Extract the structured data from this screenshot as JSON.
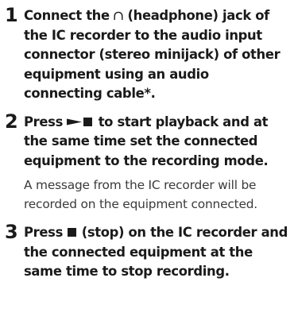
{
  "steps": [
    {
      "number": "1",
      "title_before_icon": "Connect the ",
      "title_after_icon": " (headphone) jack of the IC recorder to the audio input connector (stereo minijack) of other equipment using an audio connecting cable*."
    },
    {
      "number": "2",
      "title_before_icon": "Press ",
      "title_after_icon": " to start playback and at the same time set the connected equipment to the recording mode.",
      "note": "A message from the IC recorder will be recorded on the equipment connected."
    },
    {
      "number": "3",
      "title_before_icon": "Press ",
      "title_after_icon": " (stop) on the IC recorder and the connected equipment at the same time to stop recording."
    }
  ],
  "icons": {
    "headphone": "headphone-icon",
    "play_stop": "play-stop-icon",
    "stop": "stop-icon"
  }
}
